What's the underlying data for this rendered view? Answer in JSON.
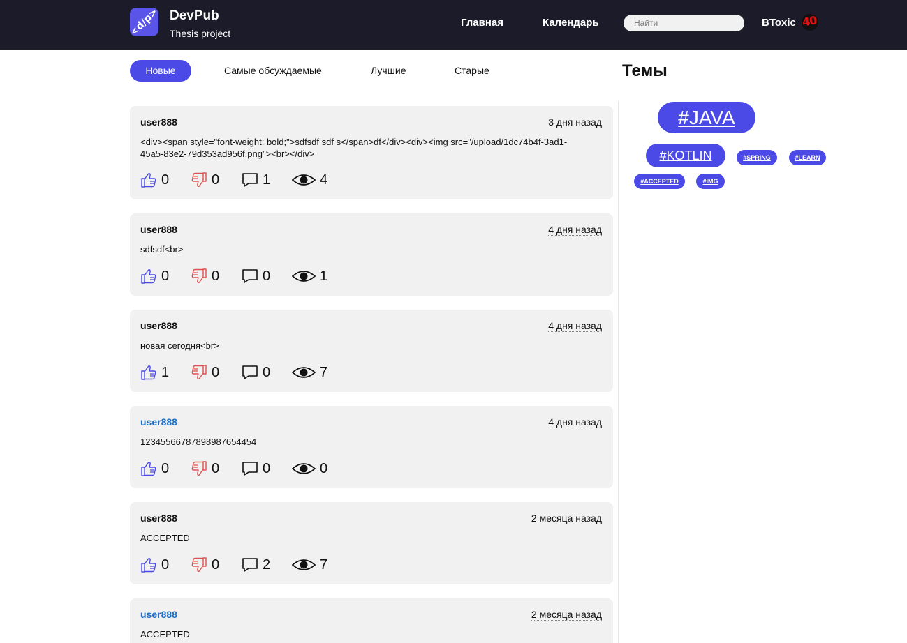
{
  "header": {
    "logo_text": "<d/p>",
    "title": "DevPub",
    "subtitle": "Thesis project",
    "nav": [
      "Главная",
      "Календарь"
    ],
    "search_placeholder": "Найти",
    "user_name": "BToxic",
    "avatar_text": "40",
    "colors": {
      "bg": "#1c1b29",
      "accent": "#4b4ae6"
    }
  },
  "tabs": [
    "Новые",
    "Самые обсуждаемые",
    "Лучшие",
    "Старые"
  ],
  "active_tab": "Новые",
  "sidebar": {
    "title": "Темы",
    "tags": [
      "#JAVA",
      "#KOTLIN",
      "#SPRING",
      "#LEARN",
      "#ACCEPTED",
      "#IMG"
    ]
  },
  "posts": [
    {
      "author": "user888",
      "time": "3 дня назад",
      "text": "<div><span style=\"font-weight: bold;\">sdfsdf sdf s</span>df</div><div><img src=\"/upload/1dc74b4f-3ad1-45a5-83e2-79d353ad956f.png\"><br></div>",
      "likes": "0",
      "dislikes": "0",
      "comments": "1",
      "views": "4"
    },
    {
      "author": "user888",
      "time": "4 дня назад",
      "text": "sdfsdf<br>",
      "likes": "0",
      "dislikes": "0",
      "comments": "0",
      "views": "1"
    },
    {
      "author": "user888",
      "time": "4 дня назад",
      "text": "новая сегодня<br>",
      "likes": "1",
      "dislikes": "0",
      "comments": "0",
      "views": "7"
    },
    {
      "author": "user888",
      "time": "4 дня назад",
      "text": "12345566787898987654454",
      "likes": "0",
      "dislikes": "0",
      "comments": "0",
      "views": "0"
    },
    {
      "author": "user888",
      "time": "2 месяца назад",
      "text": "ACCEPTED",
      "likes": "0",
      "dislikes": "0",
      "comments": "2",
      "views": "7"
    },
    {
      "author": "user888",
      "time": "2 месяца назад",
      "text": "ACCEPTED"
    }
  ],
  "icons": [
    "thumbs-up-icon",
    "thumbs-down-icon",
    "comment-icon",
    "eye-icon"
  ],
  "colors": {
    "card_bg": "#f1f1f1",
    "like": "#4b4ae6",
    "dislike": "#e05050",
    "link_author": "#1e6fc6"
  }
}
